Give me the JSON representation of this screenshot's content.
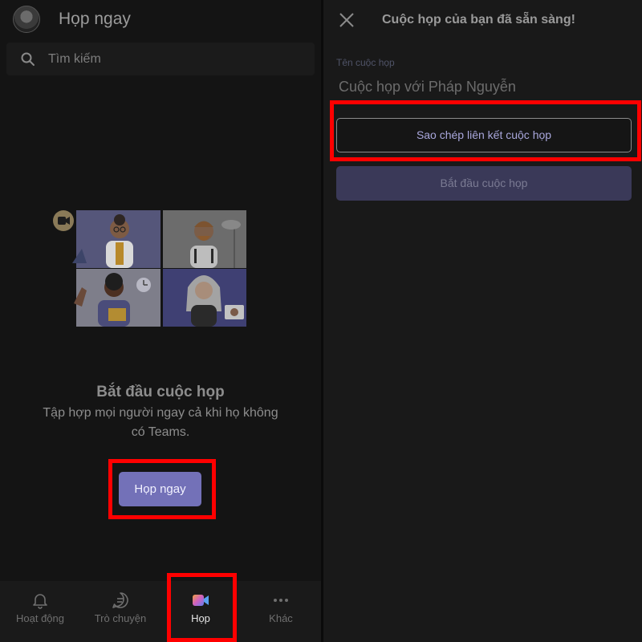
{
  "left": {
    "header": {
      "title": "Họp ngay"
    },
    "search": {
      "placeholder": "Tìm kiếm"
    },
    "empty_state": {
      "title": "Bắt đầu cuộc họp",
      "description": "Tập hợp mọi người ngay cả khi họ không có Teams.",
      "button_label": "Họp ngay"
    },
    "bottom_nav": [
      {
        "label": "Hoạt động",
        "icon": "bell-icon"
      },
      {
        "label": "Trò chuyện",
        "icon": "chat-icon"
      },
      {
        "label": "Họp",
        "icon": "video-camera-icon",
        "active": true
      },
      {
        "label": "Khác",
        "icon": "more-icon"
      }
    ]
  },
  "right": {
    "title": "Cuộc họp của bạn đã sẵn sàng!",
    "meeting_name_label": "Tên cuộc họp",
    "meeting_name_value": "Cuộc họp với Pháp Nguyễn",
    "copy_link_label": "Sao chép liên kết cuộc họp",
    "start_meeting_label": "Bắt đầu cuộc họp"
  },
  "colors": {
    "accent": "#7371b8",
    "highlight": "#ff0000",
    "background": "#141414"
  }
}
